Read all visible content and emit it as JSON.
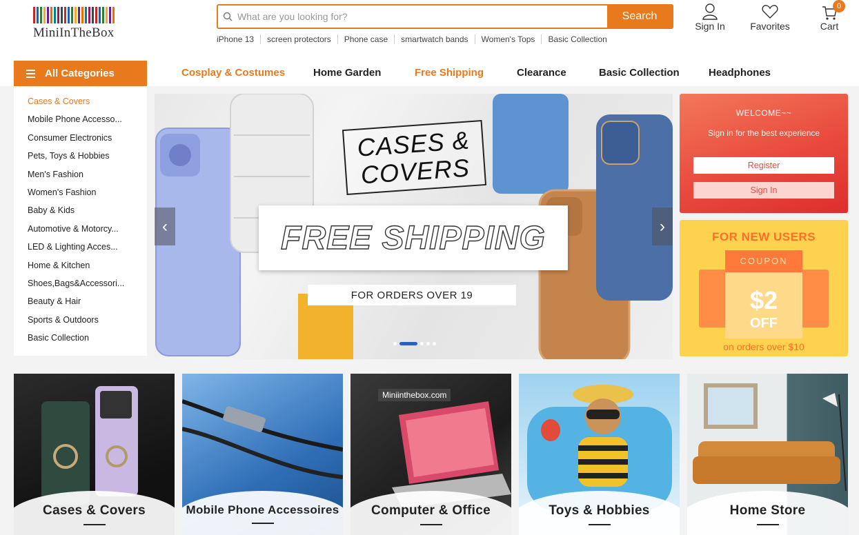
{
  "logo": {
    "text": "MiniInTheBox",
    "bar_colors": [
      "#c62828",
      "#1565c0",
      "#2e7d32",
      "#f9a825",
      "#6a1b9a",
      "#ef6c00",
      "#00838f",
      "#ad1457",
      "#37474f",
      "#c62828",
      "#1565c0",
      "#2e7d32",
      "#f9a825",
      "#6a1b9a",
      "#ef6c00",
      "#00838f",
      "#ad1457",
      "#37474f",
      "#c62828",
      "#1565c0",
      "#2e7d32",
      "#f9a825",
      "#6a1b9a",
      "#ef6c00"
    ]
  },
  "search": {
    "placeholder": "What are you looking for?",
    "value": "",
    "button_label": "Search"
  },
  "hot_words": [
    "iPhone 13",
    "screen protectors",
    "Phone case",
    "smartwatch bands",
    "Women's Tops",
    "Basic Collection"
  ],
  "header_actions": {
    "sign_in": "Sign In",
    "favorites": "Favorites",
    "cart": "Cart",
    "cart_count": "0"
  },
  "nav": {
    "all_categories": "All Categories",
    "links": [
      {
        "label": "Cosplay & Costumes",
        "highlight": true
      },
      {
        "label": "Home Garden",
        "highlight": false
      },
      {
        "label": "Free Shipping",
        "highlight": true
      },
      {
        "label": "Clearance",
        "highlight": false
      },
      {
        "label": "Basic Collection",
        "highlight": false
      },
      {
        "label": "Headphones",
        "highlight": false
      }
    ]
  },
  "categories": [
    "Cases & Covers",
    "Mobile Phone Accesso...",
    "Consumer Electronics",
    "Pets, Toys & Hobbies",
    "Men's Fashion",
    "Women's Fashion",
    "Baby & Kids",
    "Automotive & Motorcy...",
    "LED & Lighting Acces...",
    "Home & Kitchen",
    "Shoes,Bags&Accessori...",
    "Beauty & Hair",
    "Sports & Outdoors",
    "Basic Collection"
  ],
  "banner": {
    "title_line1": "CASES &",
    "title_line2": "COVERS",
    "headline": "FREE SHIPPING",
    "subline": "FOR ORDERS OVER 19",
    "prev_icon": "chevron-left-icon",
    "next_icon": "chevron-right-icon",
    "slide_count": 5,
    "active_slide": 1
  },
  "welcome": {
    "title": "WELCOME~~",
    "subtitle": "Sign in for the best experience",
    "register": "Register",
    "sign_in": "Sign In"
  },
  "coupon": {
    "heading": "FOR NEW USERS",
    "label": "COUPON",
    "amount": "$2",
    "off": "OFF",
    "footer": "on orders over $10"
  },
  "tiles": [
    {
      "label": "Cases & Covers"
    },
    {
      "label": "Mobile Phone Accessoires"
    },
    {
      "label": "Computer & Office",
      "watermark": "Miniinthebox.com"
    },
    {
      "label": "Toys & Hobbies"
    },
    {
      "label": "Home Store"
    }
  ],
  "colors": {
    "accent": "#e8791c",
    "welcome_red": "#e94a3d",
    "coupon_yellow": "#fdd24e",
    "dot_active": "#2864b5"
  }
}
